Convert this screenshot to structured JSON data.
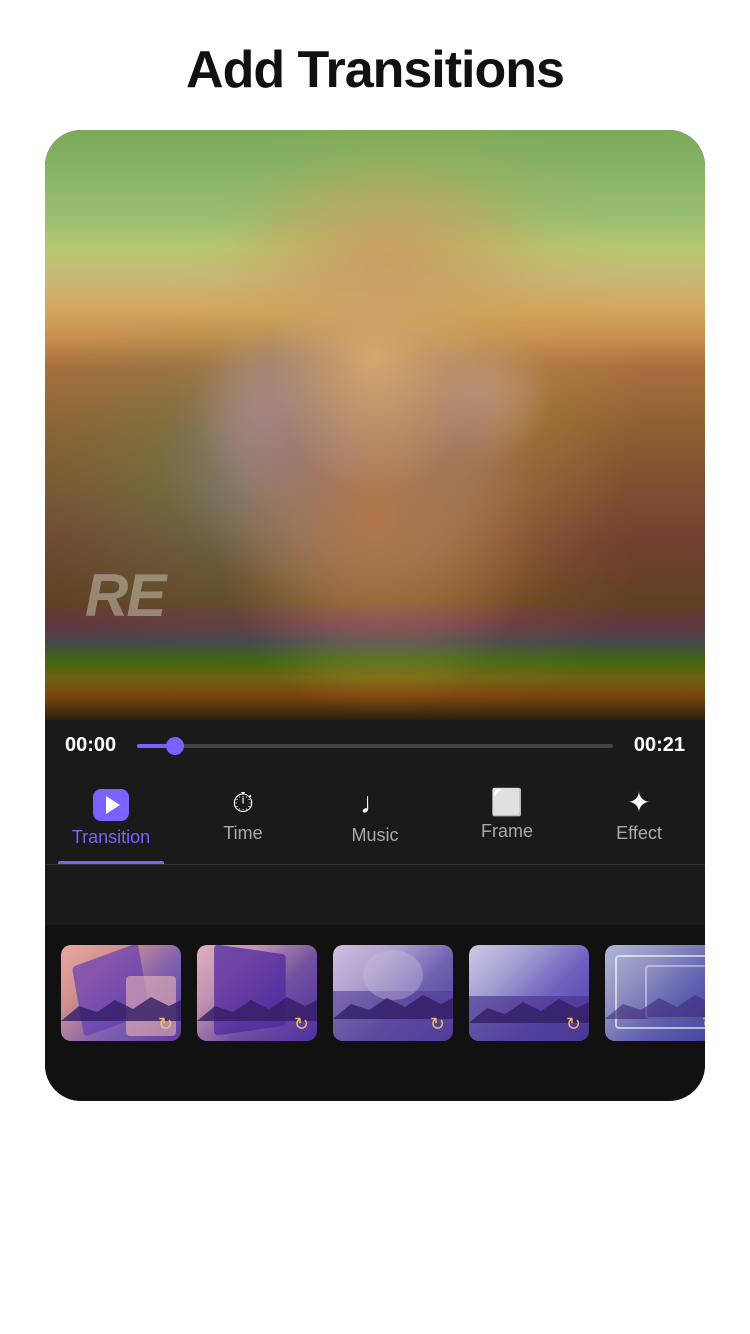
{
  "header": {
    "title": "Add Transitions"
  },
  "player": {
    "time_start": "00:00",
    "time_end": "00:21",
    "progress_percent": 8,
    "watermark": "RE"
  },
  "tabs": [
    {
      "id": "transition",
      "label": "Transition",
      "icon": "▶",
      "active": true
    },
    {
      "id": "time",
      "label": "Time",
      "icon": "⏱",
      "active": false
    },
    {
      "id": "music",
      "label": "Music",
      "icon": "♪",
      "active": false
    },
    {
      "id": "frame",
      "label": "Frame",
      "icon": "⬜",
      "active": false
    },
    {
      "id": "effect",
      "label": "Effect",
      "icon": "✦",
      "active": false
    }
  ],
  "transition_thumbnails": [
    {
      "id": 1,
      "label": "transition-1",
      "style": "thumb-bg-1",
      "shape": "thumb-shape-1"
    },
    {
      "id": 2,
      "label": "transition-2",
      "style": "thumb-bg-2",
      "shape": "thumb-shape-2"
    },
    {
      "id": 3,
      "label": "transition-3",
      "style": "thumb-bg-3",
      "shape": "thumb-shape-3"
    },
    {
      "id": 4,
      "label": "transition-4",
      "style": "thumb-bg-4",
      "shape": "thumb-shape-4"
    },
    {
      "id": 5,
      "label": "transition-5",
      "style": "thumb-bg-5",
      "shape": "thumb-shape-5"
    }
  ],
  "colors": {
    "accent": "#7b61ff",
    "background_dark": "#111111",
    "tab_bg": "#1a1a1a"
  }
}
